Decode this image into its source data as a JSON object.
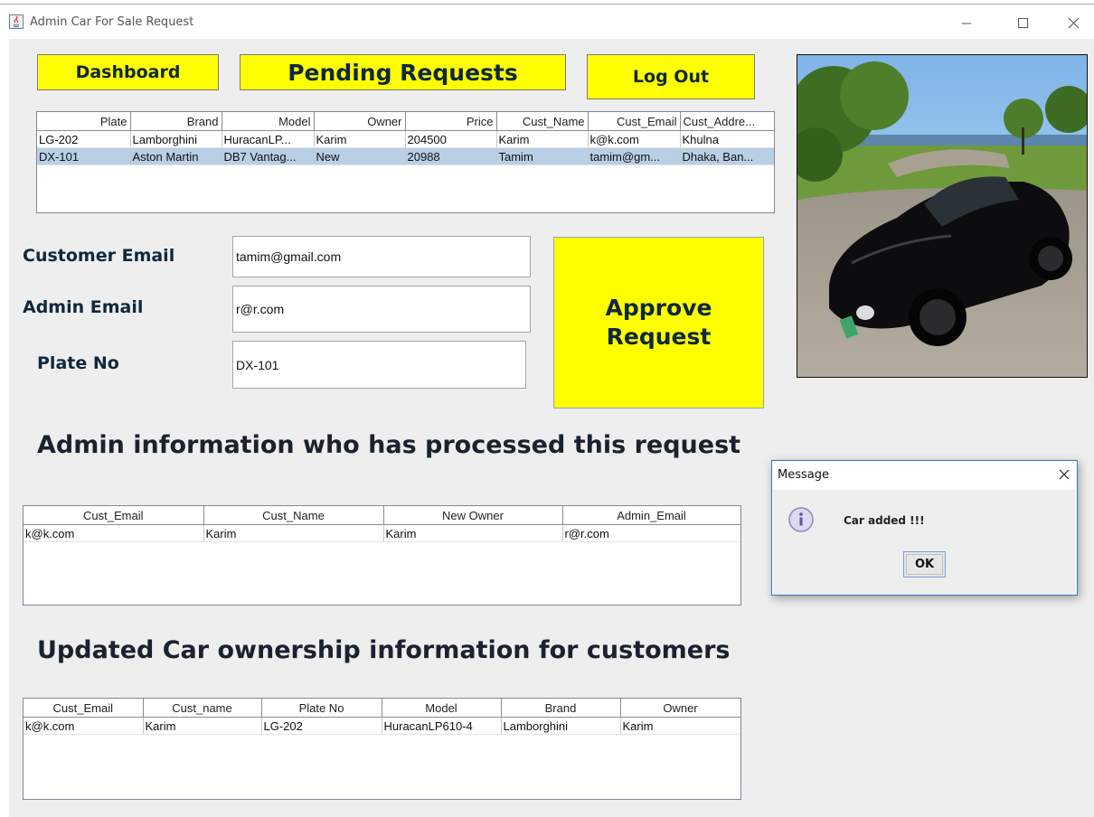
{
  "window": {
    "title": "Admin Car For Sale Request"
  },
  "nav": {
    "dashboard": "Dashboard",
    "pending": "Pending Requests",
    "logout": "Log Out"
  },
  "requests_table": {
    "columns": [
      "Plate",
      "Brand",
      "Model",
      "Owner",
      "Price",
      "Cust_Name",
      "Cust_Email",
      "Cust_Addre..."
    ],
    "rows": [
      [
        "LG-202",
        "Lamborghini",
        "HuracanLP...",
        "Karim",
        "204500",
        "Karim",
        "k@k.com",
        "Khulna"
      ],
      [
        "DX-101",
        "Aston Martin",
        "DB7 Vantag...",
        "New",
        "20988",
        "Tamim",
        "tamim@gm...",
        "Dhaka, Ban..."
      ]
    ]
  },
  "form": {
    "customer_email_label": "Customer Email",
    "customer_email_value": "tamim@gmail.com",
    "admin_email_label": "Admin Email",
    "admin_email_value": "r@r.com",
    "plate_label": "Plate No",
    "plate_value": "DX-101",
    "approve_line1": "Approve",
    "approve_line2": "Request"
  },
  "admin_section": {
    "heading": "Admin information who has processed this request",
    "columns": [
      "Cust_Email",
      "Cust_Name",
      "New Owner",
      "Admin_Email"
    ],
    "rows": [
      [
        "k@k.com",
        "Karim",
        "Karim",
        "r@r.com"
      ]
    ]
  },
  "ownership_section": {
    "heading": "Updated Car ownership information for customers",
    "columns": [
      "Cust_Email",
      "Cust_name",
      "Plate No",
      "Model",
      "Brand",
      "Owner"
    ],
    "rows": [
      [
        "k@k.com",
        "Karim",
        "LG-202",
        "HuracanLP610-4",
        "Lamborghini",
        "Karim"
      ]
    ]
  },
  "dialog": {
    "title": "Message",
    "message": "Car added !!!",
    "ok": "OK"
  },
  "colors": {
    "button_yellow": "#ffff00",
    "selection": "#b8cfe5",
    "panel": "#eeeeee",
    "dialog_border": "#2b79d0"
  },
  "icons": [
    "java-app-icon",
    "minimize-icon",
    "maximize-icon",
    "close-icon",
    "info-icon",
    "car-photo"
  ]
}
